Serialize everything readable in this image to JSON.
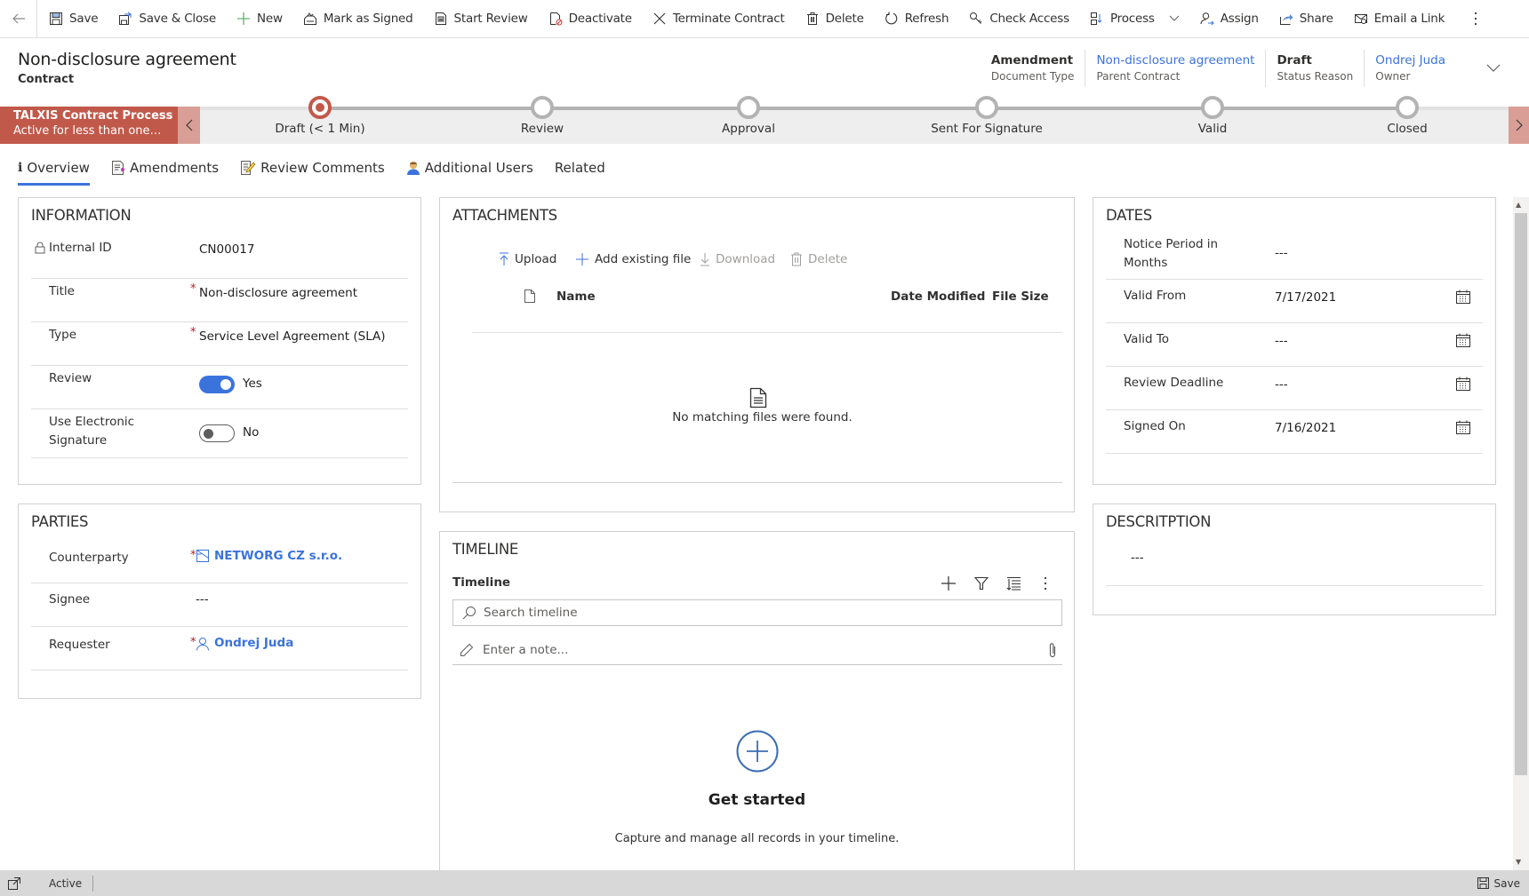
{
  "toolbar": {
    "items": [
      {
        "label": "Save",
        "icon": "save-icon"
      },
      {
        "label": "Save & Close",
        "icon": "save-close-icon"
      },
      {
        "label": "New",
        "icon": "plus-icon"
      },
      {
        "label": "Mark as Signed",
        "icon": "signed-icon"
      },
      {
        "label": "Start Review",
        "icon": "review-icon"
      },
      {
        "label": "Deactivate",
        "icon": "deactivate-icon"
      },
      {
        "label": "Terminate Contract",
        "icon": "close-icon"
      },
      {
        "label": "Delete",
        "icon": "trash-icon"
      },
      {
        "label": "Refresh",
        "icon": "refresh-icon"
      },
      {
        "label": "Check Access",
        "icon": "key-icon"
      },
      {
        "label": "Process",
        "icon": "process-icon"
      },
      {
        "label": "Assign",
        "icon": "assign-icon"
      },
      {
        "label": "Share",
        "icon": "share-icon"
      },
      {
        "label": "Email a Link",
        "icon": "email-icon"
      }
    ]
  },
  "header": {
    "title": "Non-disclosure agreement",
    "entity": "Contract",
    "fields": [
      {
        "value": "Amendment",
        "label": "Document Type",
        "link": false
      },
      {
        "value": "Non-disclosure agreement",
        "label": "Parent Contract",
        "link": true
      },
      {
        "value": "Draft",
        "label": "Status Reason",
        "link": false
      },
      {
        "value": "Ondrej Juda",
        "label": "Owner",
        "link": true
      }
    ]
  },
  "process": {
    "name": "TALXIS Contract Process",
    "status": "Active for less than one mi...",
    "stages": [
      {
        "label": "Draft  (< 1 Min)",
        "active": true
      },
      {
        "label": "Review",
        "active": false
      },
      {
        "label": "Approval",
        "active": false
      },
      {
        "label": "Sent For Signature",
        "active": false
      },
      {
        "label": "Valid",
        "active": false
      },
      {
        "label": "Closed",
        "active": false
      }
    ]
  },
  "tabs": [
    {
      "label": "Overview",
      "active": true
    },
    {
      "label": "Amendments",
      "active": false
    },
    {
      "label": "Review Comments",
      "active": false
    },
    {
      "label": "Additional Users",
      "active": false
    },
    {
      "label": "Related",
      "active": false
    }
  ],
  "information": {
    "title": "INFORMATION",
    "internal_id": {
      "label": "Internal ID",
      "value": "CN00017"
    },
    "title_field": {
      "label": "Title",
      "value": "Non-disclosure agreement"
    },
    "type": {
      "label": "Type",
      "value": "Service Level Agreement (SLA)"
    },
    "review": {
      "label": "Review",
      "value": "Yes",
      "on": true
    },
    "esign": {
      "label": "Use Electronic Signature",
      "value": "No",
      "on": false
    }
  },
  "parties": {
    "title": "PARTIES",
    "counterparty": {
      "label": "Counterparty",
      "value": "NETWORG CZ s.r.o."
    },
    "signee": {
      "label": "Signee",
      "value": "---"
    },
    "requester": {
      "label": "Requester",
      "value": "Ondrej Juda"
    }
  },
  "attachments": {
    "title": "ATTACHMENTS",
    "commands": {
      "upload": "Upload",
      "add_existing": "Add existing file",
      "download": "Download",
      "delete": "Delete"
    },
    "columns": {
      "name": "Name",
      "date_modified": "Date Modified",
      "file_size": "File Size"
    },
    "empty_text": "No matching files were found."
  },
  "timeline": {
    "title": "TIMELINE",
    "subtitle": "Timeline",
    "search_placeholder": "Search timeline",
    "note_placeholder": "Enter a note...",
    "empty_title": "Get started",
    "empty_text": "Capture and manage all records in your timeline."
  },
  "dates": {
    "title": "DATES",
    "notice_period": {
      "label": "Notice Period in Months",
      "value": "---"
    },
    "valid_from": {
      "label": "Valid From",
      "value": "7/17/2021"
    },
    "valid_to": {
      "label": "Valid To",
      "value": "---"
    },
    "review_deadline": {
      "label": "Review Deadline",
      "value": "---"
    },
    "signed_on": {
      "label": "Signed On",
      "value": "7/16/2021"
    }
  },
  "description": {
    "title": "DESCRITPTION",
    "value": "---"
  },
  "status_bar": {
    "status": "Active",
    "save_label": "Save"
  }
}
